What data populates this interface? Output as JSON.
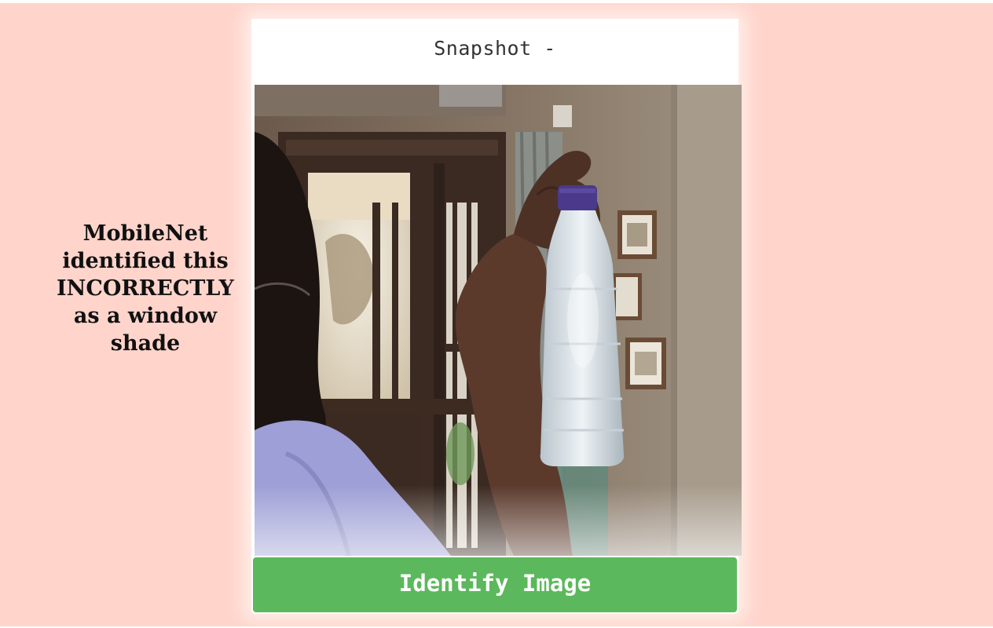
{
  "result": {
    "message": "MobileNet identified this INCORRECTLY as a window shade"
  },
  "snapshot": {
    "title": "Snapshot -",
    "image_alt": "Webcam snapshot of a person holding up a water bottle"
  },
  "actions": {
    "identify_label": "Identify Image"
  },
  "colors": {
    "page_background": "#ffd4cb",
    "button_background": "#5cb85c",
    "card_background": "#ffffff"
  }
}
